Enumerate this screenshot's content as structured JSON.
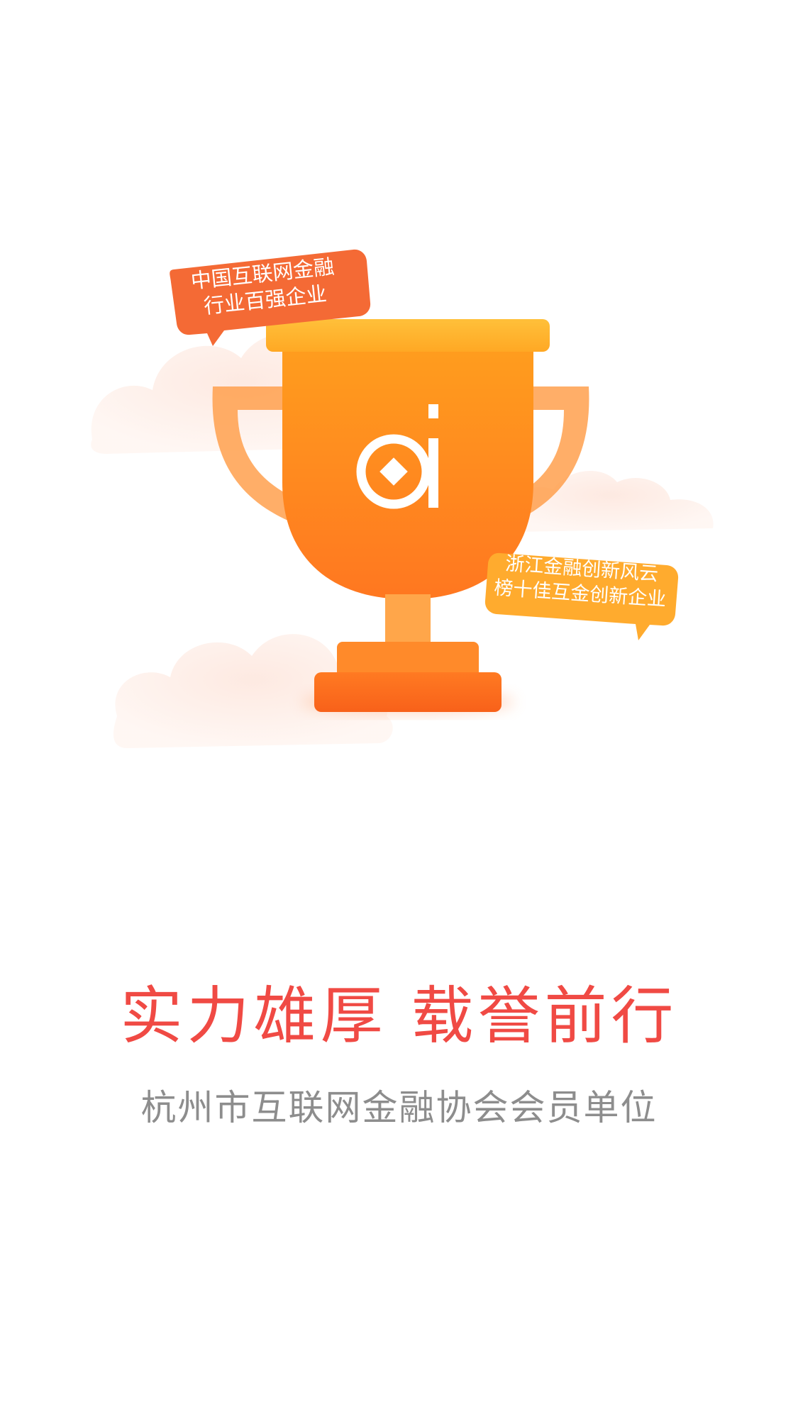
{
  "splash": {
    "badge_left": {
      "line1": "中国互联网金融",
      "line2": "行业百强企业"
    },
    "badge_right": {
      "line1": "浙江金融创新风云",
      "line2": "榜十佳互金创新企业"
    },
    "headline": "实力雄厚  载誉前行",
    "subline": "杭州市互联网金融协会会员单位"
  },
  "colors": {
    "headline": "#f04a44",
    "subline": "#8d8d8d",
    "trophy_top": "#ffb12e",
    "trophy_body": "#ff8a1e",
    "trophy_base": "#fa6a1a",
    "bubble_left": "#f46a35",
    "bubble_right": "#ffab2e"
  },
  "icons": {
    "trophy": "trophy-icon",
    "logo": "ai-coin-logo"
  }
}
